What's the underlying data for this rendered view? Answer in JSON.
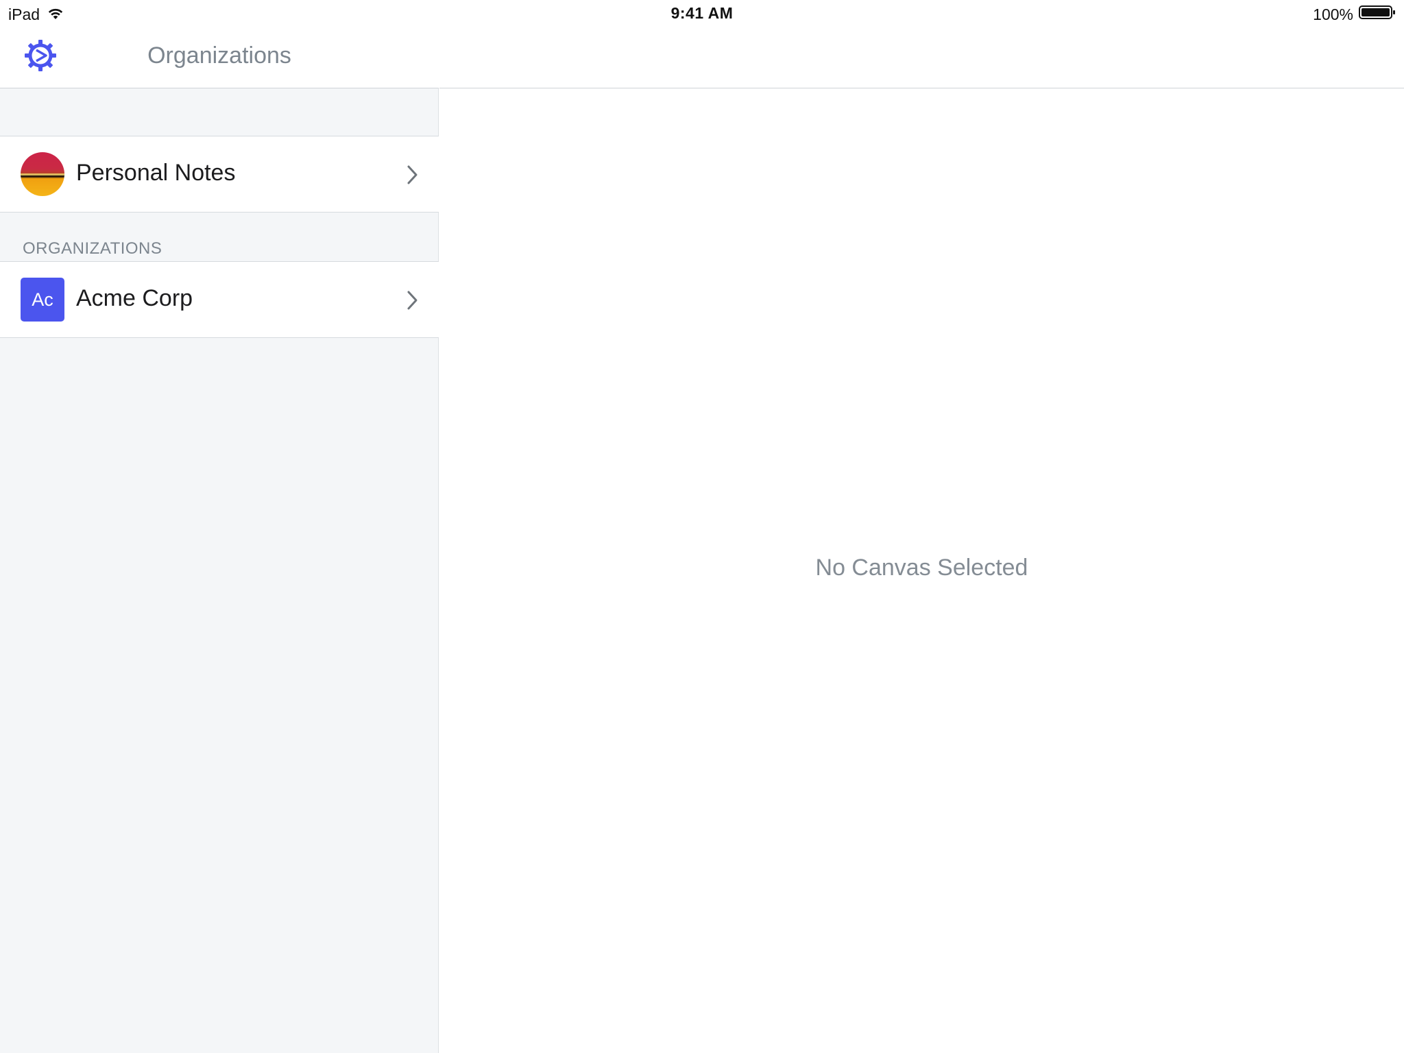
{
  "status_bar": {
    "device": "iPad",
    "time": "9:41 AM",
    "battery": "100%",
    "wifi_icon": "wifi-icon",
    "battery_icon": "battery-icon"
  },
  "master": {
    "title": "Organizations",
    "settings_icon": "gear-icon",
    "accent_color": "#4b55ee",
    "personal": {
      "label": "Personal Notes",
      "avatar": "avatar-photo"
    },
    "section_header": "ORGANIZATIONS",
    "organizations": [
      {
        "initials": "Ac",
        "label": "Acme Corp"
      }
    ]
  },
  "detail": {
    "empty_message": "No Canvas Selected"
  }
}
